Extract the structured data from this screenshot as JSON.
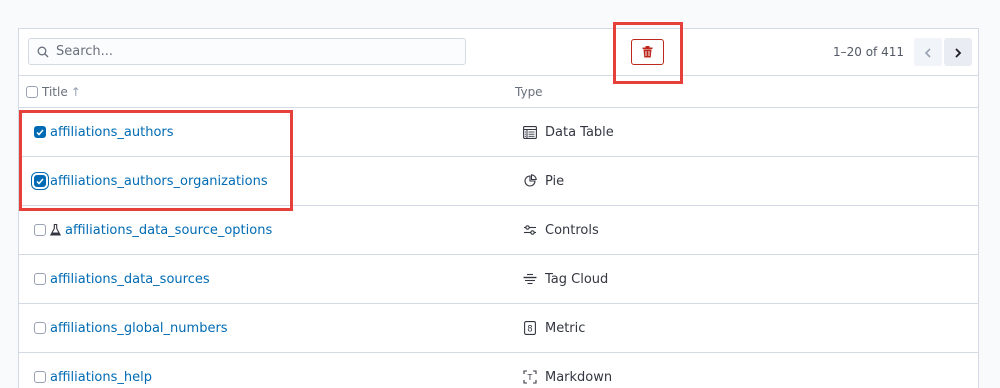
{
  "search": {
    "placeholder": "Search..."
  },
  "toolbar": {
    "delete_label": "Delete"
  },
  "pagination": {
    "text": "1–20 of 411"
  },
  "table": {
    "columns": {
      "title": "Title",
      "type": "Type"
    },
    "sort_indicator": "↑",
    "rows": [
      {
        "title": "affiliations_authors",
        "type": "Data Table",
        "type_icon": "table-icon",
        "checked": true,
        "experimental": false
      },
      {
        "title": "affiliations_authors_organizations",
        "type": "Pie",
        "type_icon": "pie-icon",
        "checked": true,
        "experimental": false
      },
      {
        "title": "affiliations_data_source_options",
        "type": "Controls",
        "type_icon": "controls-icon",
        "checked": false,
        "experimental": true
      },
      {
        "title": "affiliations_data_sources",
        "type": "Tag Cloud",
        "type_icon": "tag-cloud-icon",
        "checked": false,
        "experimental": false
      },
      {
        "title": "affiliations_global_numbers",
        "type": "Metric",
        "type_icon": "metric-icon",
        "checked": false,
        "experimental": false
      },
      {
        "title": "affiliations_help",
        "type": "Markdown",
        "type_icon": "markdown-icon",
        "checked": false,
        "experimental": false
      }
    ]
  },
  "colors": {
    "link": "#006bb4",
    "danger": "#bd271e",
    "highlight": "#e5403a",
    "border": "#d3dae6"
  }
}
